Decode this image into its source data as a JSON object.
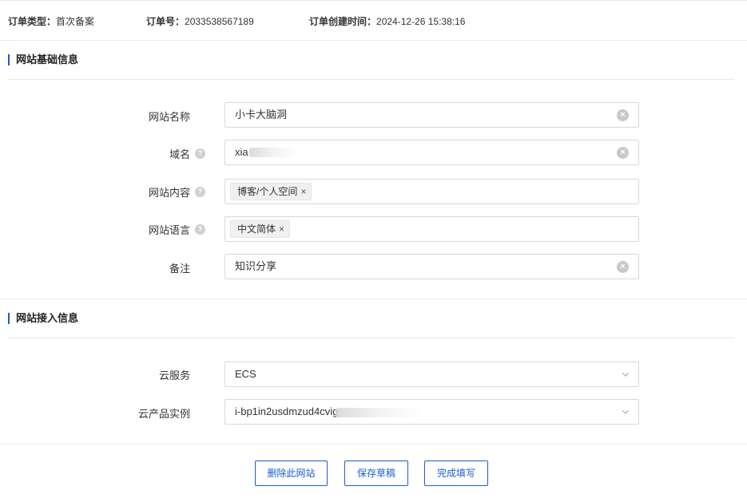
{
  "order": {
    "type_label": "订单类型：",
    "type_value": "首次备案",
    "number_label": "订单号：",
    "number_value": "2033538567189",
    "created_label": "订单创建时间：",
    "created_value": "2024-12-26 15:38:16"
  },
  "site_basic": {
    "title": "网站基础信息",
    "fields": {
      "name": {
        "label": "网站名称",
        "value": "小卡大脑洞"
      },
      "domain": {
        "label": "域名",
        "value": "xia"
      },
      "content": {
        "label": "网站内容",
        "tags": [
          "博客/个人空间"
        ]
      },
      "language": {
        "label": "网站语言",
        "tags": [
          "中文简体"
        ]
      },
      "remark": {
        "label": "备注",
        "value": "知识分享"
      }
    }
  },
  "site_access": {
    "title": "网站接入信息",
    "fields": {
      "cloud_service": {
        "label": "云服务",
        "value": "ECS"
      },
      "instance": {
        "label": "云产品实例",
        "value": "i-bp1in2usdmzud4cvig"
      }
    }
  },
  "actions": {
    "delete_label": "删除此网站",
    "save_draft_label": "保存草稿",
    "complete_label": "完成填写"
  },
  "icons": {
    "help": "?",
    "clear": "×",
    "tag_close": "×"
  },
  "colors": {
    "accent": "#1a5dc9",
    "border": "#d8d8d8",
    "divider": "#e8e8e8"
  }
}
